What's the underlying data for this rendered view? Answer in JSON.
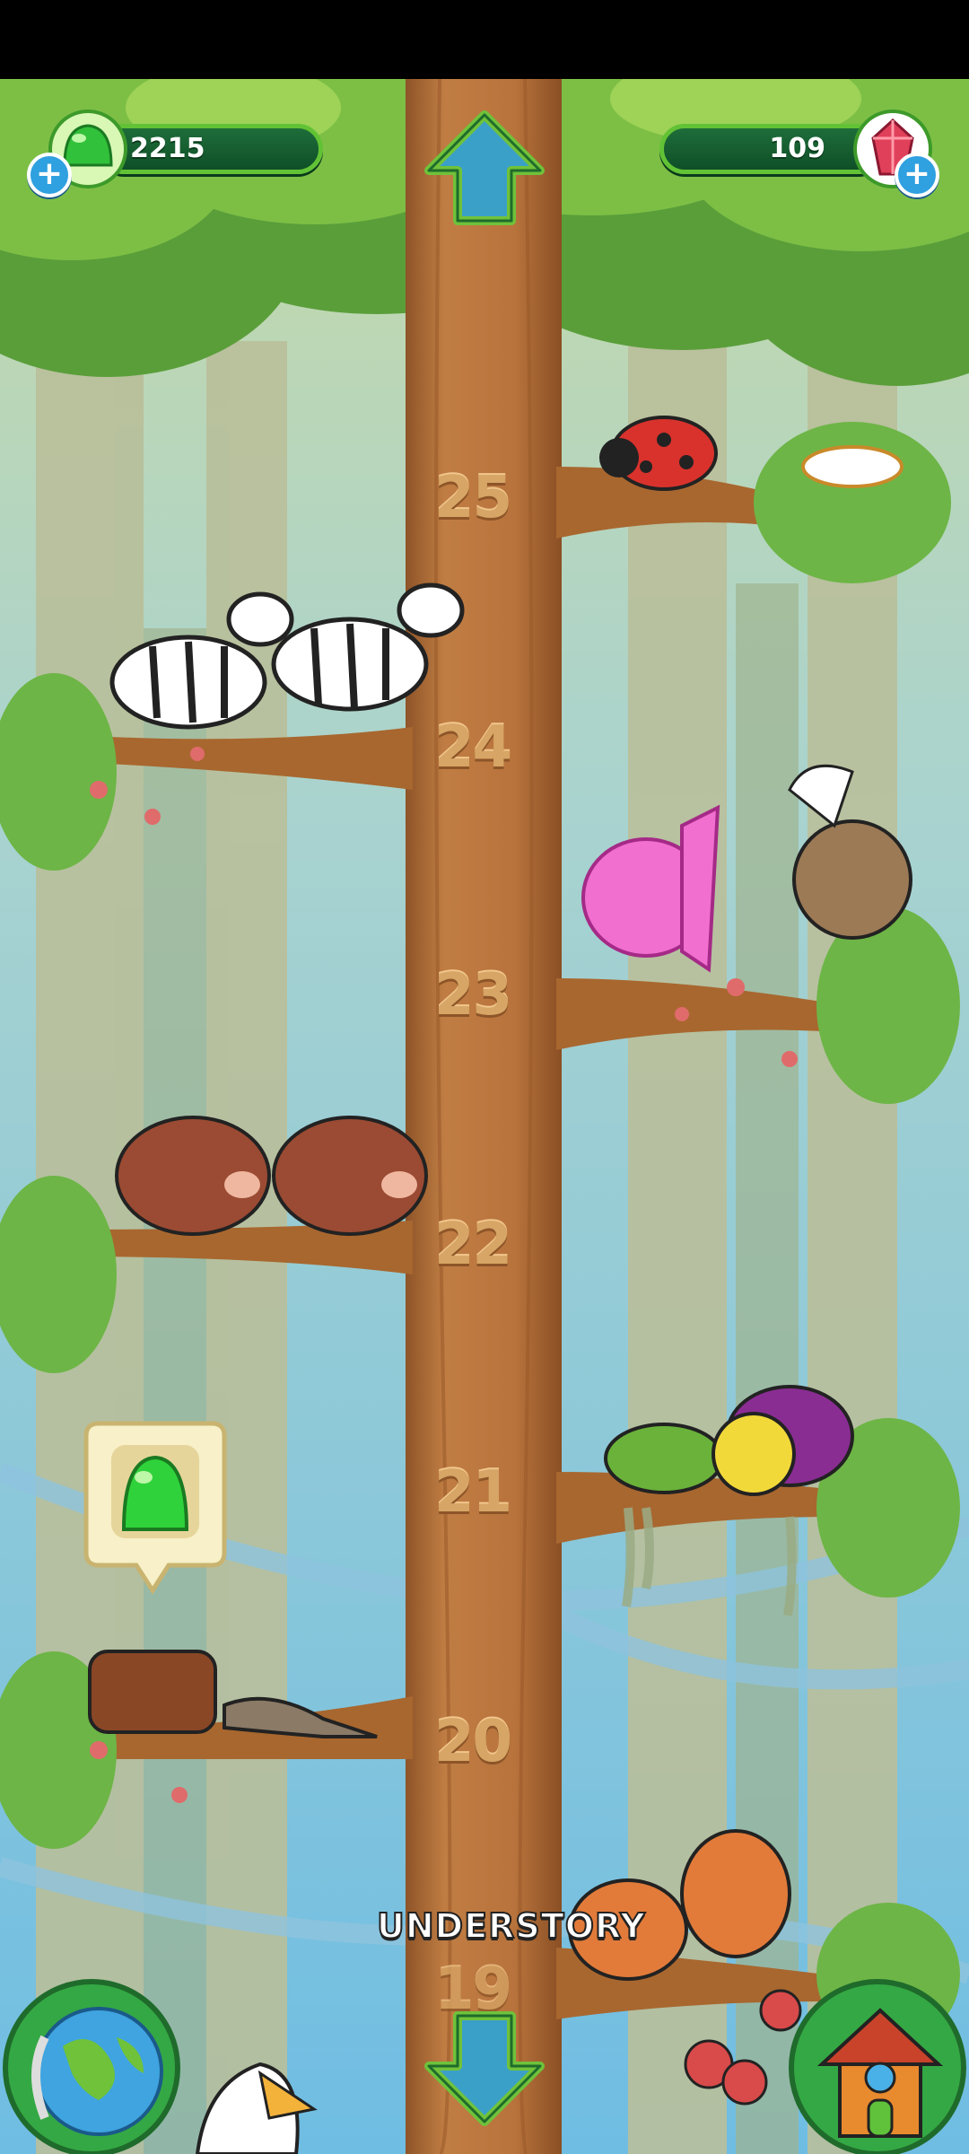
{
  "hud": {
    "gems_green_count": "2215",
    "gems_red_count": "109",
    "plus_symbol": "+"
  },
  "tree": {
    "levels": [
      "25",
      "24",
      "23",
      "22",
      "21",
      "20",
      "19"
    ],
    "area_name": "UNDERSTORY"
  },
  "icons": {
    "green_gem": "green-jelly-gem-icon",
    "red_gem": "red-crystal-gem-icon",
    "up": "arrow-up-icon",
    "down": "arrow-down-icon",
    "globe": "globe-icon",
    "house": "birdhouse-icon"
  },
  "colors": {
    "accent_green": "#62c235",
    "trunk": "#b8733c",
    "plus_blue": "#2fa0e0"
  }
}
